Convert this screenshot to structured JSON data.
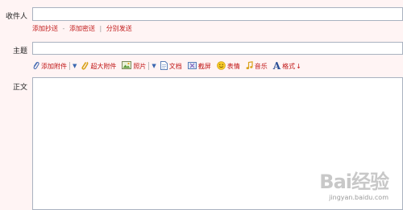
{
  "form": {
    "recipient_label": "收件人",
    "subject_label": "主题",
    "body_label": "正文",
    "recipient_value": "",
    "subject_value": "",
    "body_value": ""
  },
  "recipient_links": {
    "add_cc": "添加抄送",
    "dash": "-",
    "add_bcc": "添加密送",
    "pipe": "|",
    "separate_send": "分别发送"
  },
  "toolbar": {
    "add_attachment": "添加附件",
    "large_attachment": "超大附件",
    "photo": "照片",
    "document": "文档",
    "screenshot": "截屏",
    "emoticon": "表情",
    "music": "音乐",
    "format": "格式",
    "format_arrow": "↓"
  },
  "icons": {
    "attachment": "paperclip-icon",
    "large_attachment": "paperclip-large-icon",
    "photo": "image-icon",
    "document": "document-icon",
    "screenshot": "screenshot-icon",
    "emoticon": "smiley-icon",
    "music": "music-note-icon",
    "format": "font-a-icon"
  },
  "watermark": {
    "brand": "Bai经验",
    "url": "jingyan.baidu.com"
  },
  "colors": {
    "background": "#fff4f4",
    "link_red": "#c01818",
    "field_border": "#a9b2c0"
  }
}
